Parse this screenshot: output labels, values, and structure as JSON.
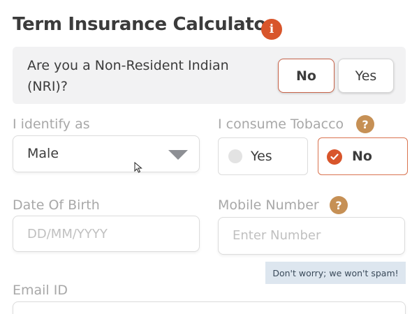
{
  "header": {
    "title": "Term Insurance Calculator",
    "info_icon_glyph": "i"
  },
  "nri": {
    "question": "Are you a Non-Resident Indian (NRI)?",
    "options": [
      "No",
      "Yes"
    ],
    "selected": "No"
  },
  "gender": {
    "label": "I identify as",
    "value": "Male"
  },
  "tobacco": {
    "label": "I consume Tobacco",
    "help_glyph": "?",
    "options": [
      "Yes",
      "No"
    ],
    "selected": "No"
  },
  "dob": {
    "label": "Date Of Birth",
    "placeholder": "DD/MM/YYYY"
  },
  "mobile": {
    "label": "Mobile Number",
    "help_glyph": "?",
    "placeholder": "Enter Number",
    "hint": "Don't worry; we won't spam!"
  },
  "email": {
    "label": "Email ID"
  },
  "colors": {
    "accent": "#d8552b",
    "help": "#c69055",
    "nri_box": "#f2f2f3"
  }
}
